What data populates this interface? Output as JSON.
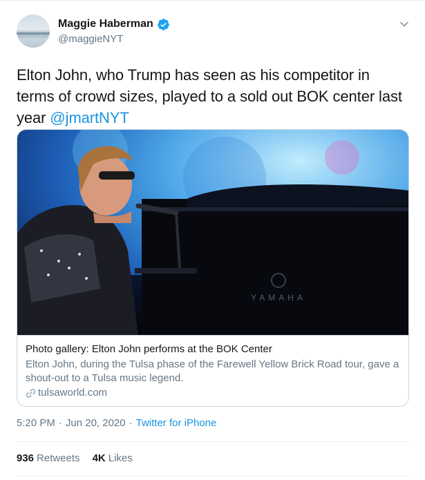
{
  "author": {
    "display_name": "Maggie Haberman",
    "handle": "@maggieNYT",
    "verified_icon": "verified-badge-icon"
  },
  "tweet": {
    "text": "Elton John, who Trump has seen as his competitor in terms of crowd sizes, played to a sold out BOK center last year ",
    "mention": "@jmartNYT"
  },
  "card": {
    "title": "Photo gallery: Elton John performs at the BOK Center",
    "description": "Elton John, during the Tulsa phase of the Farewell Yellow Brick Road tour, gave a shout-out to a Tulsa music legend.",
    "domain": "tulsaworld.com",
    "piano_brand": "YAMAHA"
  },
  "meta": {
    "time": "5:20 PM",
    "separator": "·",
    "date": "Jun 20, 2020",
    "separator2": "·",
    "source": "Twitter for iPhone"
  },
  "stats": {
    "retweets_count": "936",
    "retweets_label": "Retweets",
    "likes_count": "4K",
    "likes_label": "Likes"
  },
  "colors": {
    "accent": "#1b95e0",
    "secondary_text": "#657786",
    "border": "#ccd6dd"
  }
}
